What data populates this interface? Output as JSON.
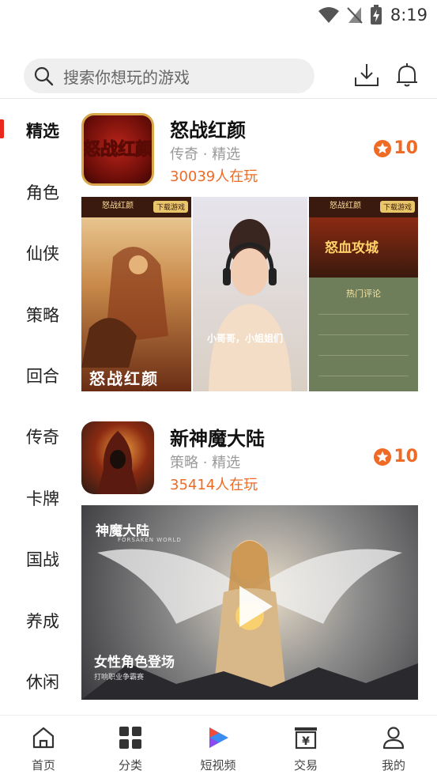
{
  "status_bar": {
    "time": "8:19",
    "icons": [
      "wifi-icon",
      "no-signal-icon",
      "battery-charging-icon"
    ]
  },
  "search": {
    "placeholder": "搜索你想玩的游戏",
    "icons": [
      "search-icon",
      "download-icon",
      "bell-icon"
    ]
  },
  "categories": [
    {
      "label": "精选",
      "active": true
    },
    {
      "label": "角色",
      "active": false
    },
    {
      "label": "仙侠",
      "active": false
    },
    {
      "label": "策略",
      "active": false
    },
    {
      "label": "回合",
      "active": false
    },
    {
      "label": "传奇",
      "active": false
    },
    {
      "label": "卡牌",
      "active": false
    },
    {
      "label": "国战",
      "active": false
    },
    {
      "label": "养成",
      "active": false
    },
    {
      "label": "休闲",
      "active": false
    }
  ],
  "games": [
    {
      "title": "怒战红颜",
      "tags": "传奇 · 精选",
      "players": "30039人在玩",
      "score": "10",
      "icon_text": "怒战红颜",
      "shot1": {
        "header": "怒战红颜",
        "button": "下载游戏",
        "caption": "怒战红颜"
      },
      "shot2": {
        "caption": "小哥哥，小姐姐们"
      },
      "shot3": {
        "header": "怒战红颜",
        "button": "下载游戏",
        "banner": "怒血攻城",
        "section": "热门评论"
      }
    },
    {
      "title": "新神魔大陆",
      "tags": "策略 · 精选",
      "players": "35414人在玩",
      "score": "10",
      "banner": {
        "logo": "神魔大陆",
        "sublogo": "FORSAKEN WORLD",
        "caption": "女性角色登场",
        "subcaption": "打响职业争霸赛"
      }
    }
  ],
  "bottom_nav": [
    {
      "label": "首页",
      "icon": "home-icon"
    },
    {
      "label": "分类",
      "icon": "category-grid-icon"
    },
    {
      "label": "短视频",
      "icon": "short-video-icon"
    },
    {
      "label": "交易",
      "icon": "trade-icon"
    },
    {
      "label": "我的",
      "icon": "profile-icon"
    }
  ],
  "colors": {
    "accent": "#ef6a25",
    "indicator": "#e8291c",
    "search_bg": "#efefef"
  }
}
